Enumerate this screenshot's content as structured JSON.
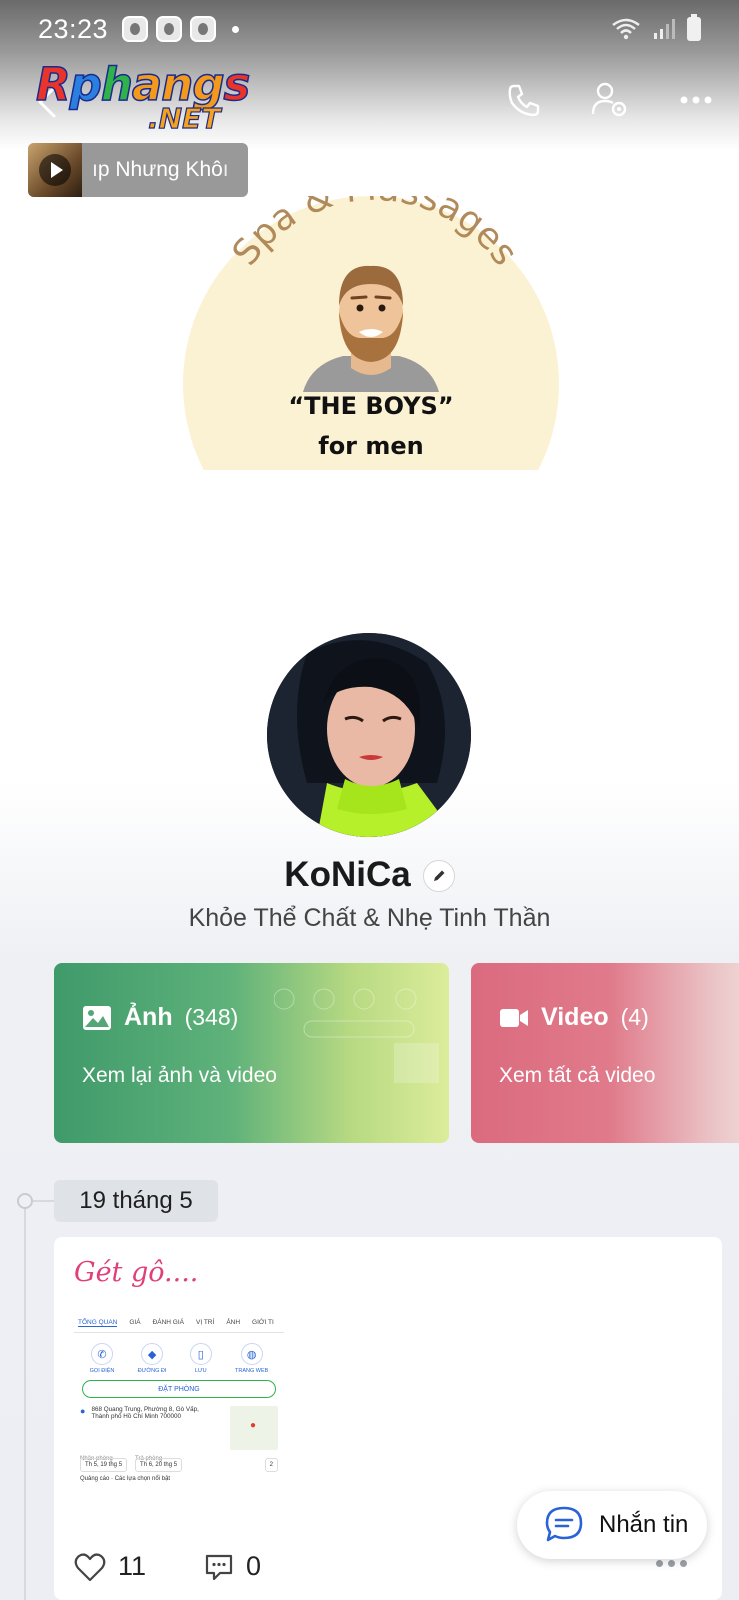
{
  "status_bar": {
    "time": "23:23"
  },
  "watermark": {
    "part1": "R",
    "part2": "p",
    "part3": "h",
    "part4": "ang",
    "part5": "s",
    "sub": ".NET"
  },
  "music": {
    "title": "ıp Nhưng Khôı"
  },
  "cover": {
    "arc_text": "Spa & Massages",
    "line1": "“THE BOYS”",
    "line2": "for men"
  },
  "profile": {
    "name": "KoNiCa",
    "bio": "Khỏe Thể Chất & Nhẹ Tinh Thần"
  },
  "media_cards": {
    "photos": {
      "title": "Ảnh",
      "count": "(348)",
      "subtitle": "Xem lại ảnh và video"
    },
    "videos": {
      "title": "Video",
      "count": "(4)",
      "subtitle": "Xem tất cả video"
    }
  },
  "timeline": {
    "date": "19 tháng 5"
  },
  "post": {
    "caption": "Gét gô....",
    "likes": "11",
    "comments": "0",
    "image": {
      "tabs": [
        "TỔNG QUAN",
        "GIÁ",
        "ĐÁNH GIÁ",
        "VỊ TRÍ",
        "ẢNH",
        "GIỚI TI"
      ],
      "actions": [
        "GỌI ĐIỆN",
        "ĐƯỜNG ĐI",
        "LƯU",
        "TRANG WEB"
      ],
      "book": "ĐẶT PHÒNG",
      "address": "868 Quang Trung, Phường 8, Gò Vấp, Thành phố Hồ Chí Minh 700000",
      "checkin_label": "Nhận phòng",
      "checkout_label": "Trả phòng",
      "checkin": "Th 5, 19 thg 5",
      "checkout": "Th 6, 20 thg 5",
      "guests": "2",
      "ads": "Quảng cáo · Các lựa chọn nổi bật"
    }
  },
  "fab": {
    "label": "Nhắn tin"
  },
  "colors": {
    "accent": "#2a63d6",
    "photo_card": "#3f9a6a",
    "video_card": "#db6a7e",
    "caption": "#e0407a"
  }
}
